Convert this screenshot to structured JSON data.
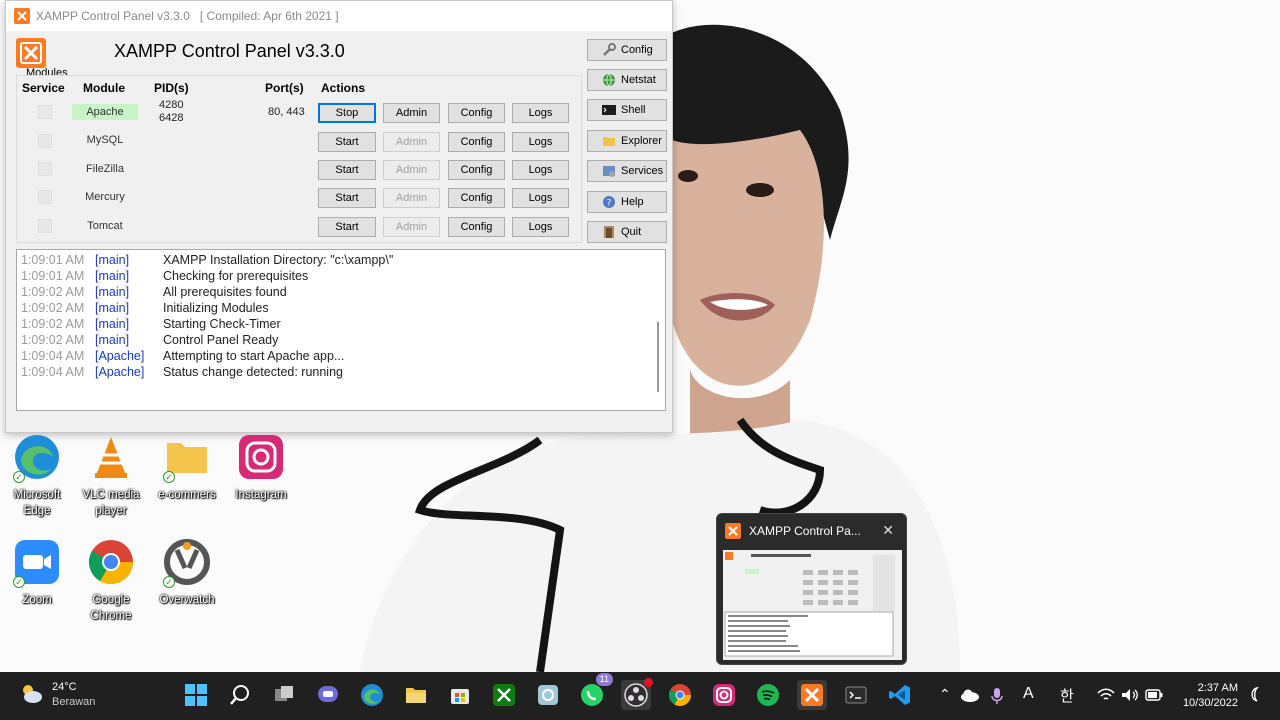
{
  "window": {
    "title": "XAMPP Control Panel v3.3.0",
    "compiled": "[ Compiled: Apr 6th 2021 ]",
    "panel_title": "XAMPP Control Panel v3.3.0",
    "modules_label": "Modules",
    "headers": {
      "service": "Service",
      "module": "Module",
      "pids": "PID(s)",
      "ports": "Port(s)",
      "actions": "Actions"
    },
    "modules": [
      {
        "name": "Apache",
        "pid": "4280\n6428",
        "port": "80, 443",
        "action": "Stop",
        "admin": "Admin",
        "config": "Config",
        "logs": "Logs",
        "running": true
      },
      {
        "name": "MySQL",
        "pid": "",
        "port": "",
        "action": "Start",
        "admin": "Admin",
        "config": "Config",
        "logs": "Logs",
        "running": false
      },
      {
        "name": "FileZilla",
        "pid": "",
        "port": "",
        "action": "Start",
        "admin": "Admin",
        "config": "Config",
        "logs": "Logs",
        "running": false
      },
      {
        "name": "Mercury",
        "pid": "",
        "port": "",
        "action": "Start",
        "admin": "Admin",
        "config": "Config",
        "logs": "Logs",
        "running": false
      },
      {
        "name": "Tomcat",
        "pid": "",
        "port": "",
        "action": "Start",
        "admin": "Admin",
        "config": "Config",
        "logs": "Logs",
        "running": false
      }
    ],
    "side_buttons": [
      {
        "label": "Config",
        "icon": "wrench-icon"
      },
      {
        "label": "Netstat",
        "icon": "globe-icon"
      },
      {
        "label": "Shell",
        "icon": "terminal-icon"
      },
      {
        "label": "Explorer",
        "icon": "folder-icon"
      },
      {
        "label": "Services",
        "icon": "services-icon"
      },
      {
        "label": "Help",
        "icon": "help-icon"
      },
      {
        "label": "Quit",
        "icon": "quit-icon"
      }
    ],
    "log": [
      {
        "time": "1:09:01 AM",
        "src": "[main]",
        "msg": "XAMPP Installation Directory: \"c:\\xampp\\\""
      },
      {
        "time": "1:09:01 AM",
        "src": "[main]",
        "msg": "Checking for prerequisites"
      },
      {
        "time": "1:09:02 AM",
        "src": "[main]",
        "msg": "All prerequisites found"
      },
      {
        "time": "1:09:02 AM",
        "src": "[main]",
        "msg": "Initializing Modules"
      },
      {
        "time": "1:09:02 AM",
        "src": "[main]",
        "msg": "Starting Check-Timer"
      },
      {
        "time": "1:09:02 AM",
        "src": "[main]",
        "msg": "Control Panel Ready"
      },
      {
        "time": "1:09:04 AM",
        "src": "[Apache]",
        "msg": "Attempting to start Apache app..."
      },
      {
        "time": "1:09:04 AM",
        "src": "[Apache]",
        "msg": "Status change detected: running"
      }
    ]
  },
  "desktop_icons": [
    {
      "label": "Microsoft Edge",
      "icon": "edge-icon"
    },
    {
      "label": "VLC media player",
      "icon": "vlc-icon"
    },
    {
      "label": "e-commers",
      "icon": "folder-icon"
    },
    {
      "label": "Instagram",
      "icon": "instagram-icon"
    },
    {
      "label": "Zoom",
      "icon": "zoom-icon"
    },
    {
      "label": "Google Chrome",
      "icon": "chrome-icon"
    },
    {
      "label": "Overwatch",
      "icon": "overwatch-icon"
    }
  ],
  "thumbnail": {
    "title": "XAMPP Control Pa...",
    "close": "✕"
  },
  "taskbar": {
    "weather_temp": "24°C",
    "weather_desc": "Berawan",
    "whatsapp_badge": "11",
    "lang": "A",
    "ime": "한",
    "time": "2:37 AM",
    "date": "10/30/2022"
  },
  "colors": {
    "running": "#c8f3c8",
    "log_source": "#1d3bb8",
    "taskbar": "#202020",
    "xampp_orange": "#fb7a24"
  }
}
